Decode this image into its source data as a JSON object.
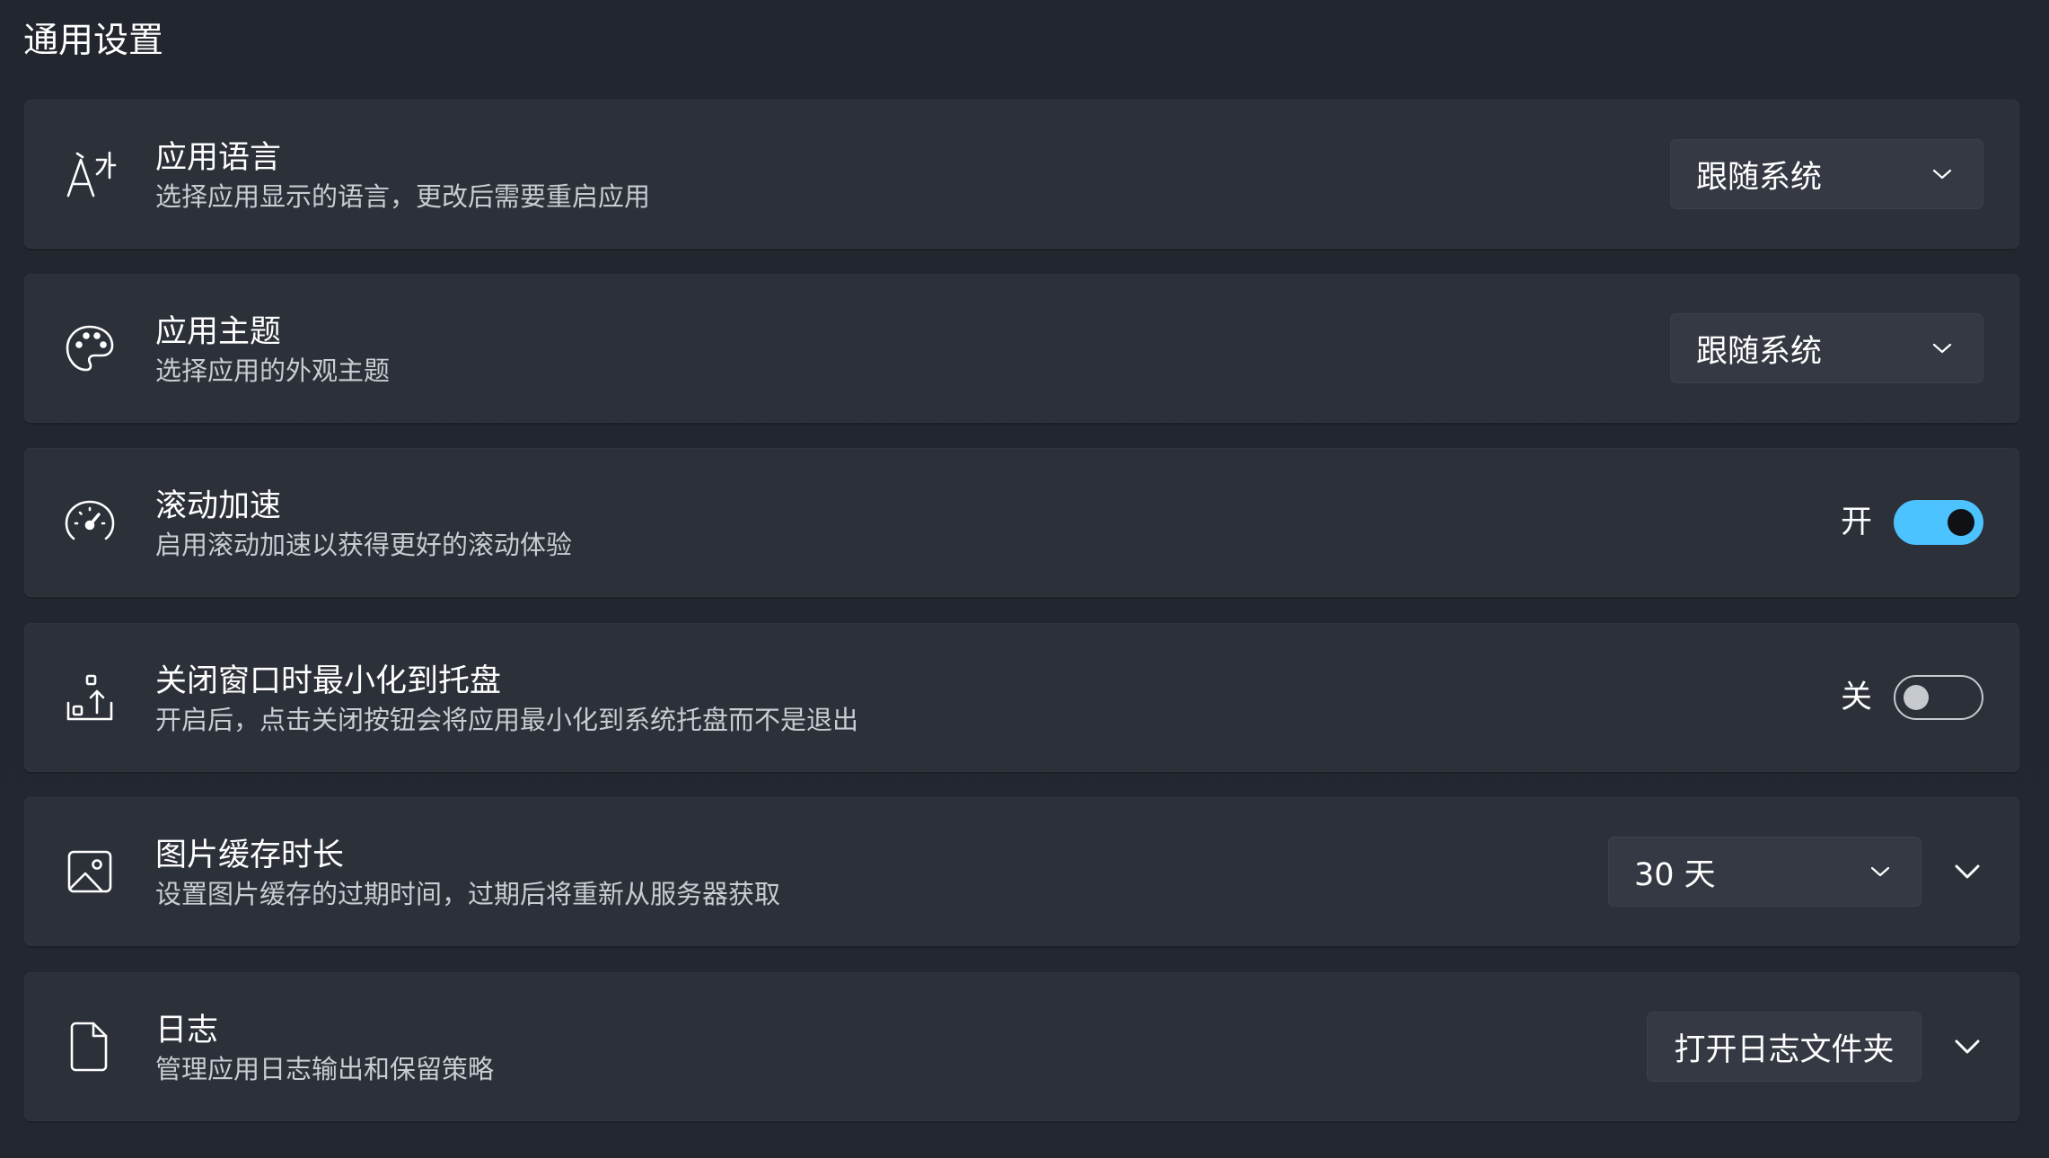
{
  "page": {
    "title": "通用设置"
  },
  "settings": [
    {
      "icon": "language-icon",
      "title": "应用语言",
      "desc": "选择应用显示的语言，更改后需要重启应用",
      "control": "dropdown",
      "value": "跟随系统"
    },
    {
      "icon": "palette-icon",
      "title": "应用主题",
      "desc": "选择应用的外观主题",
      "control": "dropdown",
      "value": "跟随系统"
    },
    {
      "icon": "speedometer-icon",
      "title": "滚动加速",
      "desc": "启用滚动加速以获得更好的滚动体验",
      "control": "toggle",
      "toggle_label": "开",
      "toggle_on": true
    },
    {
      "icon": "tray-minimize-icon",
      "title": "关闭窗口时最小化到托盘",
      "desc": "开启后，点击关闭按钮会将应用最小化到系统托盘而不是退出",
      "control": "toggle",
      "toggle_label": "关",
      "toggle_on": false
    },
    {
      "icon": "image-icon",
      "title": "图片缓存时长",
      "desc": "设置图片缓存的过期时间，过期后将重新从服务器获取",
      "control": "dropdown-expander",
      "value": "30 天"
    },
    {
      "icon": "document-icon",
      "title": "日志",
      "desc": "管理应用日志输出和保留策略",
      "control": "button-expander",
      "button_label": "打开日志文件夹"
    }
  ],
  "colors": {
    "accent": "#4cc2ff",
    "background": "#22262e",
    "card": "#2c3039",
    "control": "#353943"
  }
}
